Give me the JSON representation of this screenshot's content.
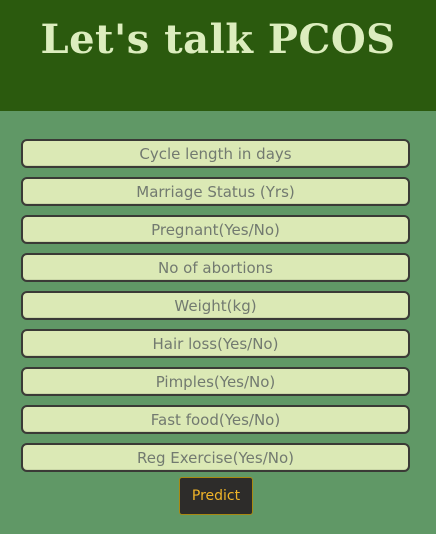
{
  "header": {
    "title": "Let's talk PCOS"
  },
  "form": {
    "fields": [
      {
        "placeholder": "Cycle length in days",
        "value": ""
      },
      {
        "placeholder": "Marriage Status (Yrs)",
        "value": ""
      },
      {
        "placeholder": "Pregnant(Yes/No)",
        "value": ""
      },
      {
        "placeholder": "No of abortions",
        "value": ""
      },
      {
        "placeholder": "Weight(kg)",
        "value": ""
      },
      {
        "placeholder": "Hair loss(Yes/No)",
        "value": ""
      },
      {
        "placeholder": "Pimples(Yes/No)",
        "value": ""
      },
      {
        "placeholder": "Fast food(Yes/No)",
        "value": ""
      },
      {
        "placeholder": "Reg Exercise(Yes/No)",
        "value": ""
      }
    ],
    "submit_label": "Predict"
  },
  "colors": {
    "header_background": "#2b5a0e",
    "page_background": "#609866",
    "title_text": "#dcedbe",
    "field_background": "#dbe9b5",
    "button_background": "#2d2c2a",
    "button_text": "#f0b428"
  }
}
